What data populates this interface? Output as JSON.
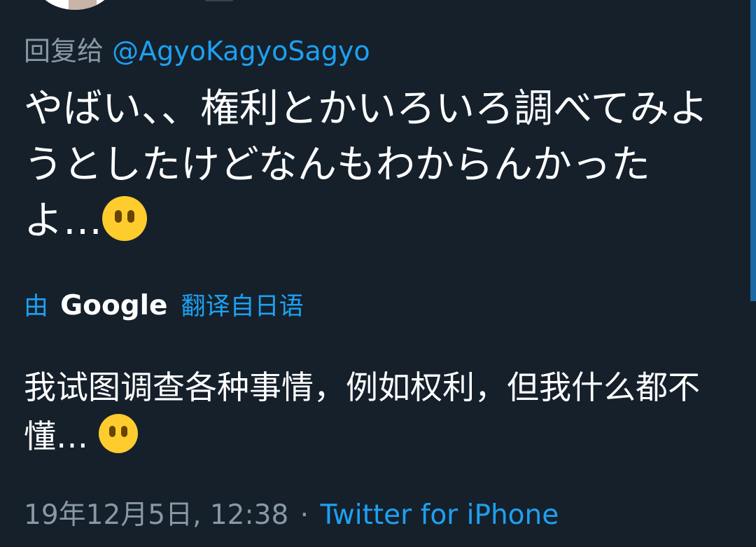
{
  "reply": {
    "prefix": "回复给",
    "handle": "@AgyoKagyoSagyo"
  },
  "tweet": {
    "text": "やばい、、権利とかいろいろ調べてみようとしたけどなんもわからんかったよ…",
    "emoji": "neutral-face-no-mouth"
  },
  "translation": {
    "by": "由",
    "provider": "Google",
    "label": "翻译自日语",
    "text": "我试图调查各种事情，例如权利，但我什么都不懂…"
  },
  "meta": {
    "timestamp": "19年12月5日, 12:38",
    "separator": "·",
    "source": "Twitter for iPhone"
  },
  "colors": {
    "background": "#15202b",
    "accent": "#1da1f2",
    "secondary_text": "#8899a6"
  }
}
